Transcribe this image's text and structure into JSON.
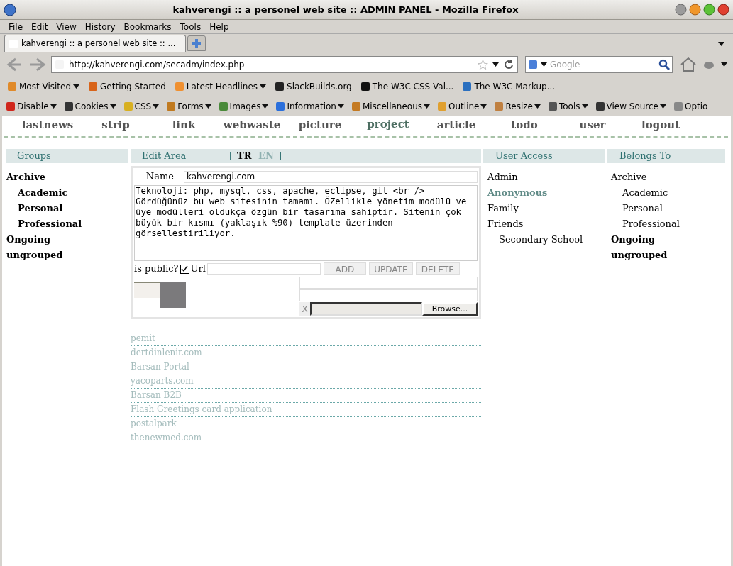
{
  "window": {
    "title": "kahverengi :: a personel web site :: ADMIN PANEL - Mozilla Firefox"
  },
  "menu_bar": [
    "File",
    "Edit",
    "View",
    "History",
    "Bookmarks",
    "Tools",
    "Help"
  ],
  "tabs": [
    {
      "label": "kahverengi :: a personel web site :: ...",
      "selected": true
    }
  ],
  "address_bar": {
    "url": "http://kahverengi.com/secadm/index.php"
  },
  "search": {
    "placeholder": "Google"
  },
  "bookmarks": [
    {
      "label": "Most Visited",
      "kind": "menu"
    },
    {
      "label": "Getting Started",
      "kind": "link"
    },
    {
      "label": "Latest Headlines",
      "kind": "menu"
    },
    {
      "label": "SlackBuilds.org",
      "kind": "link"
    },
    {
      "label": "The W3C CSS Val...",
      "kind": "link"
    },
    {
      "label": "The W3C Markup...",
      "kind": "link"
    }
  ],
  "dev_toolbar": [
    "Disable",
    "Cookies",
    "CSS",
    "Forms",
    "Images",
    "Information",
    "Miscellaneous",
    "Outline",
    "Resize",
    "Tools",
    "View Source",
    "Optio"
  ],
  "site_nav": [
    {
      "label": "lastnews",
      "selected": false
    },
    {
      "label": "strip",
      "selected": false
    },
    {
      "label": "link",
      "selected": false
    },
    {
      "label": "webwaste",
      "selected": false
    },
    {
      "label": "picture",
      "selected": false
    },
    {
      "label": "project",
      "selected": true
    },
    {
      "label": "article",
      "selected": false
    },
    {
      "label": "todo",
      "selected": false
    },
    {
      "label": "user",
      "selected": false
    },
    {
      "label": "logout",
      "selected": false
    }
  ],
  "groups": {
    "title": "Groups",
    "items": [
      {
        "label": "Archive",
        "children": [
          {
            "label": "Academic"
          },
          {
            "label": "Personal"
          },
          {
            "label": "Professional"
          }
        ]
      },
      {
        "label": "Ongoing"
      },
      {
        "label": "ungrouped"
      }
    ]
  },
  "edit_area": {
    "title": "Edit Area",
    "open_bracket": "[",
    "close_bracket": "]",
    "languages": [
      {
        "label": "TR",
        "selected": true
      },
      {
        "label": "EN",
        "selected": false
      }
    ],
    "name_label": "Name",
    "name_value": "kahverengi.com",
    "description": "Teknoloji: php, mysql, css, apache, eclipse, git <br />\nGördüğünüz bu web sitesinin tamamı. ÖZellikle yönetim modülü ve üye modülleri oldukça özgün bir tasarıma sahiptir. Sitenin çok büyük bir kısmı (yaklaşık %90) template üzerinden görsellestiriliyor.",
    "public_label": "is public?",
    "public_checked": true,
    "url_label": "Url",
    "buttons": [
      "ADD",
      "UPDATE",
      "DELETE"
    ],
    "clear_label": "X",
    "browse_label": "Browse..."
  },
  "user_access": {
    "title": "User Access",
    "items": [
      {
        "label": "Admin",
        "selected": false
      },
      {
        "label": "Anonymous",
        "selected": true
      },
      {
        "label": "Family",
        "selected": false
      },
      {
        "label": "Friends",
        "selected": false,
        "children": [
          {
            "label": "Secondary School",
            "selected": false
          }
        ]
      }
    ]
  },
  "belongs_to": {
    "title": "Belongs To",
    "items": [
      {
        "label": "Archive",
        "selected": false,
        "children": [
          {
            "label": "Academic",
            "selected": false
          },
          {
            "label": "Personal",
            "selected": false
          },
          {
            "label": "Professional",
            "selected": false
          }
        ]
      },
      {
        "label": "Ongoing",
        "selected": true
      },
      {
        "label": "ungrouped",
        "selected": true
      }
    ]
  },
  "projects": [
    "pemit",
    "dertdinlenir.com",
    "Barsan Portal",
    "yacoparts.com",
    "Barsan B2B",
    "Flash Greetings card application",
    "postalpark",
    "thenewmed.com"
  ]
}
